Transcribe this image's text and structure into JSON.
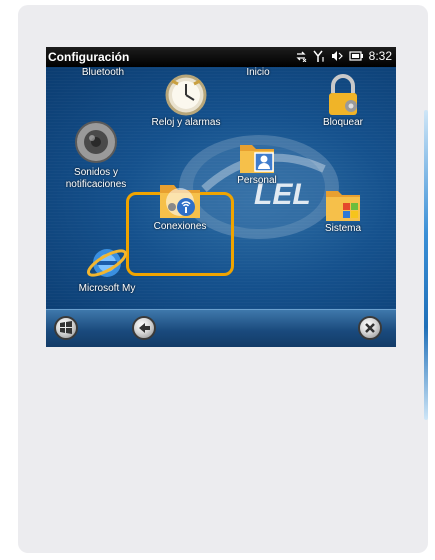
{
  "screen": {
    "title": "Configuración",
    "time": "8:32"
  },
  "items": {
    "bluetooth": "Bluetooth",
    "reloj": "Reloj y alarmas",
    "inicio": "Inicio",
    "bloquear": "Bloquear",
    "sonidos": "Sonidos y notificaciones",
    "personal": "Personal",
    "conexiones": "Conexiones",
    "sistema": "Sistema",
    "microsoft": "Microsoft My"
  },
  "colors": {
    "selection": "#f0a400",
    "desktop": "#15518d"
  }
}
